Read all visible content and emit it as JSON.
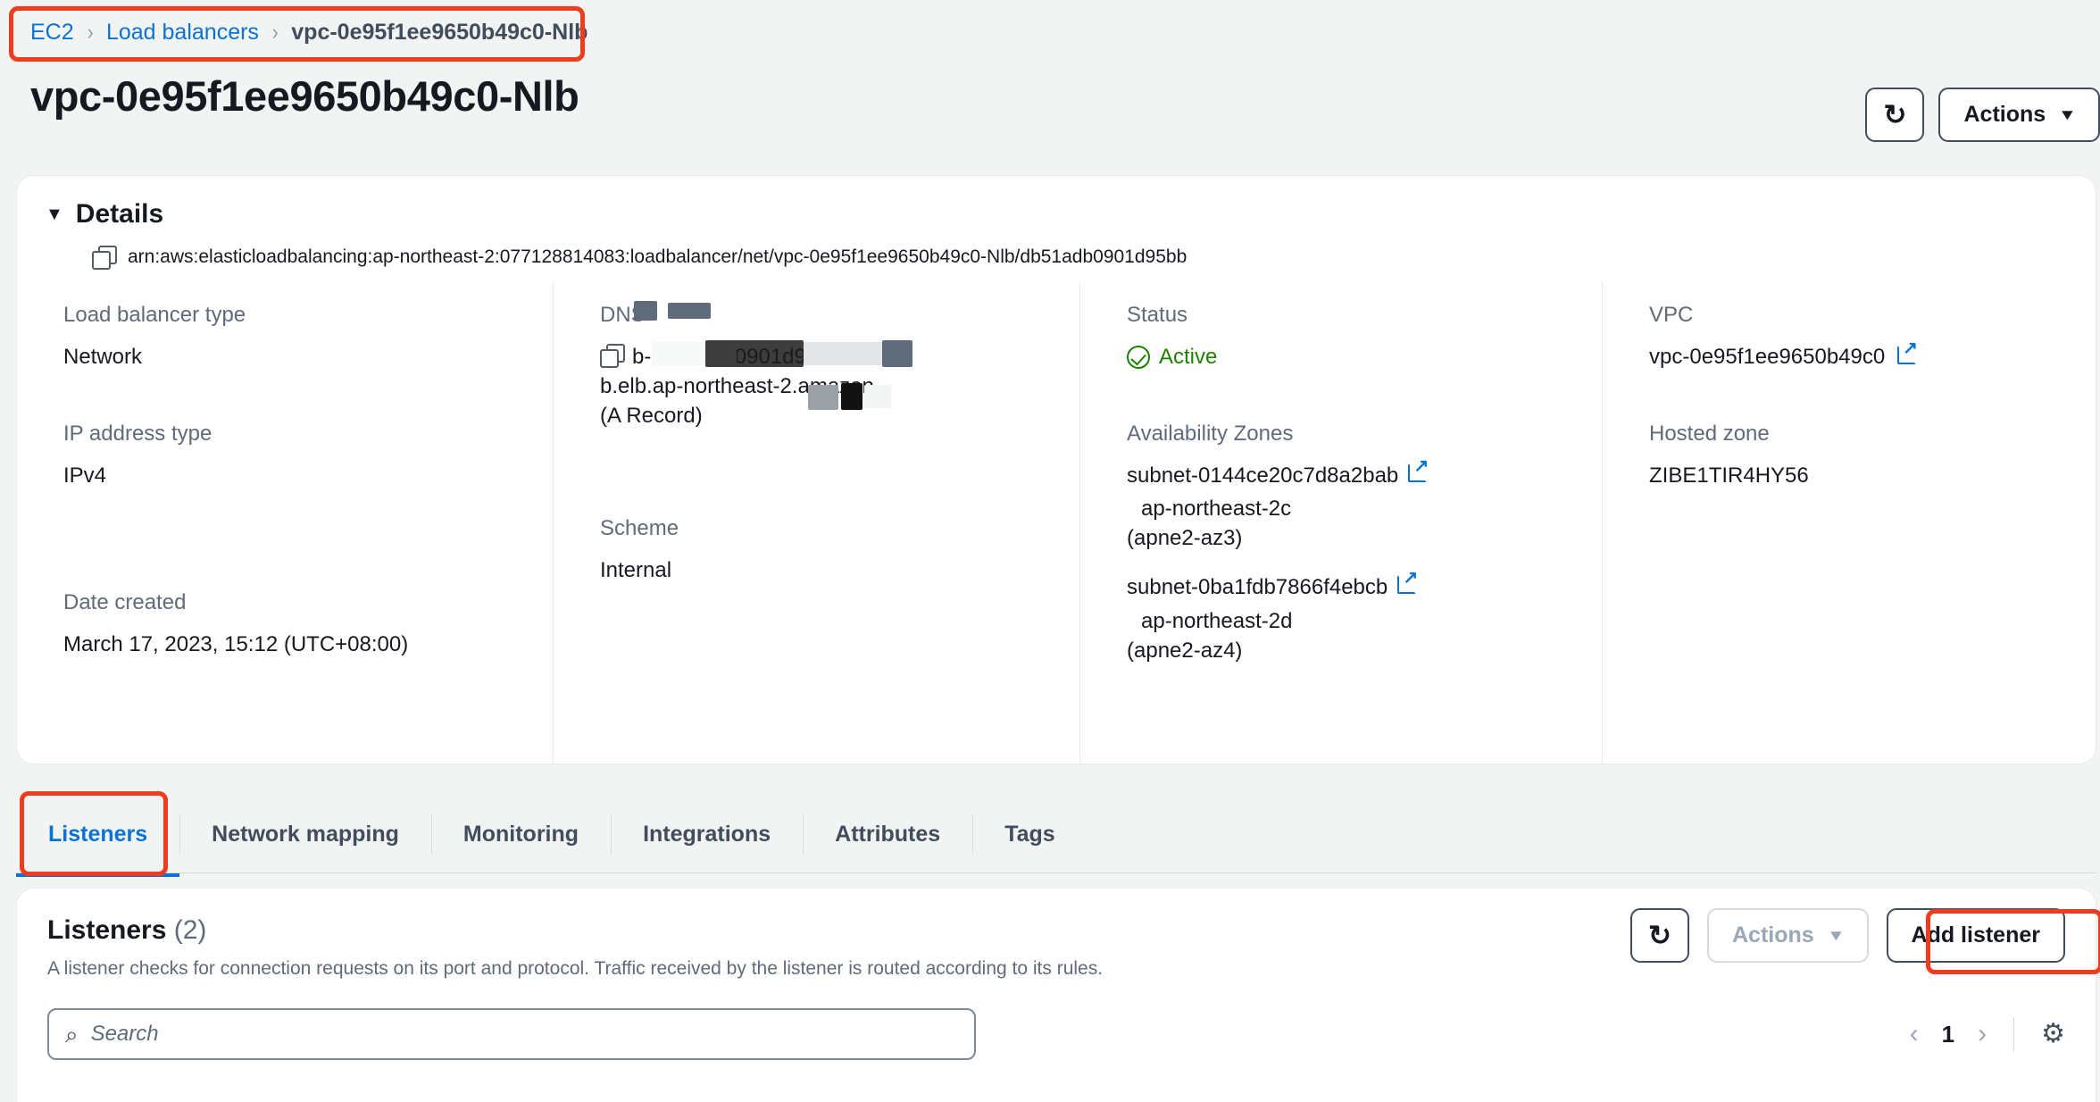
{
  "breadcrumb": {
    "items": [
      {
        "label": "EC2",
        "type": "link"
      },
      {
        "label": "Load balancers",
        "type": "link"
      },
      {
        "label": "vpc-0e95f1ee9650b49c0-Nlb",
        "type": "current"
      }
    ],
    "separator": "›"
  },
  "header": {
    "title": "vpc-0e95f1ee9650b49c0-Nlb",
    "refresh_icon": "refresh-icon",
    "refresh_glyph": "↻",
    "actions_label": "Actions",
    "caret": "▼"
  },
  "details": {
    "disclosure": "▼",
    "title": "Details",
    "arn": "arn:aws:elasticloadbalancing:ap-northeast-2:077128814083:loadbalancer/net/vpc-0e95f1ee9650b49c0-Nlb/db51adb0901d95bb",
    "copy_icon": "copy-icon",
    "fields": {
      "load_balancer_type": {
        "label": "Load balancer type",
        "value": "Network"
      },
      "dns_name": {
        "label": "DNS",
        "value_line1": "b-db51adb0901d95b",
        "value_line2": "b.elb.ap-northeast-2.amazon",
        "value_line3": "(A Record)"
      },
      "status": {
        "label": "Status",
        "value": "Active",
        "icon": "check-circle-icon",
        "color": "#1d8102"
      },
      "vpc": {
        "label": "VPC",
        "value": "vpc-0e95f1ee9650b49c0",
        "icon": "external-link-icon"
      },
      "ip_address_type": {
        "label": "IP address type",
        "value": "IPv4"
      },
      "scheme": {
        "label": "Scheme",
        "value": "Internal"
      },
      "availability_zones": {
        "label": "Availability Zones",
        "zones": [
          {
            "subnet": "subnet-0144ce20c7d8a2bab",
            "zone": "ap-northeast-2c",
            "zone_id": "(apne2-az3)"
          },
          {
            "subnet": "subnet-0ba1fdb7866f4ebcb",
            "zone": "ap-northeast-2d",
            "zone_id": "(apne2-az4)"
          }
        ]
      },
      "hosted_zone": {
        "label": "Hosted zone",
        "value": "ZIBE1TIR4HY56"
      },
      "date_created": {
        "label": "Date created",
        "value": "March 17, 2023, 15:12 (UTC+08:00)"
      }
    }
  },
  "tabs": [
    {
      "label": "Listeners",
      "active": true
    },
    {
      "label": "Network mapping",
      "active": false
    },
    {
      "label": "Monitoring",
      "active": false
    },
    {
      "label": "Integrations",
      "active": false
    },
    {
      "label": "Attributes",
      "active": false
    },
    {
      "label": "Tags",
      "active": false
    }
  ],
  "listeners_panel": {
    "title": "Listeners",
    "count": "(2)",
    "description": "A listener checks for connection requests on its port and protocol. Traffic received by the listener is routed according to its rules.",
    "refresh_glyph": "↻",
    "actions_label": "Actions",
    "actions_caret": "▼",
    "actions_disabled": true,
    "add_listener_label": "Add listener",
    "search_placeholder": "Search",
    "search_value": "",
    "search_glyph": "⌕",
    "pagination": {
      "prev": "‹",
      "page": "1",
      "next": "›",
      "settings_icon": "gear-icon",
      "settings_glyph": "⚙"
    }
  },
  "annotations": {
    "highlight_color": "#f03c1e",
    "boxes": [
      "breadcrumb",
      "listeners-tab",
      "add-listener-button"
    ]
  }
}
